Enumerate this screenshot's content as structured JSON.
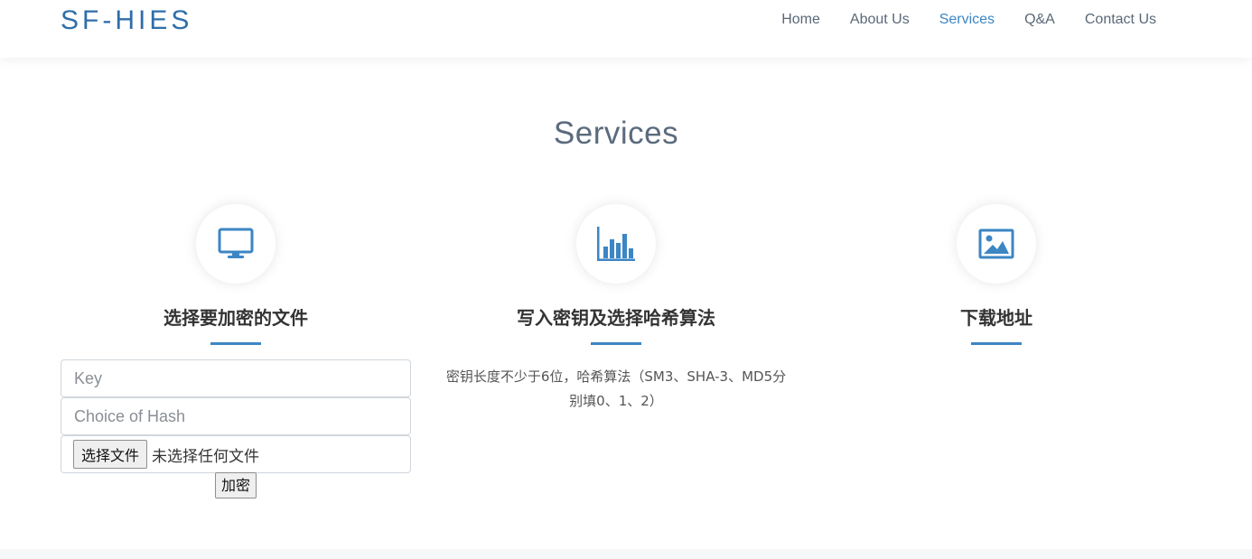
{
  "brand": "SF-HIES",
  "nav": {
    "items": [
      {
        "label": "Home",
        "active": false
      },
      {
        "label": "About Us",
        "active": false
      },
      {
        "label": "Services",
        "active": true
      },
      {
        "label": "Q&A",
        "active": false
      },
      {
        "label": "Contact Us",
        "active": false
      }
    ]
  },
  "section": {
    "title": "Services",
    "columns": [
      {
        "icon": "monitor-icon",
        "title": "选择要加密的文件",
        "key_placeholder": "Key",
        "hash_placeholder": "Choice of Hash",
        "file_button": "选择文件",
        "file_status": "未选择任何文件",
        "submit_label": "加密"
      },
      {
        "icon": "bar-chart-icon",
        "title": "写入密钥及选择哈希算法",
        "description": "密钥长度不少于6位，哈希算法（SM3、SHA-3、MD5分别填0、1、2）"
      },
      {
        "icon": "image-icon",
        "title": "下载地址"
      }
    ]
  },
  "colors": {
    "accent": "#3c86c4",
    "brand": "#2f6eaa",
    "title": "#5b6b7d"
  }
}
